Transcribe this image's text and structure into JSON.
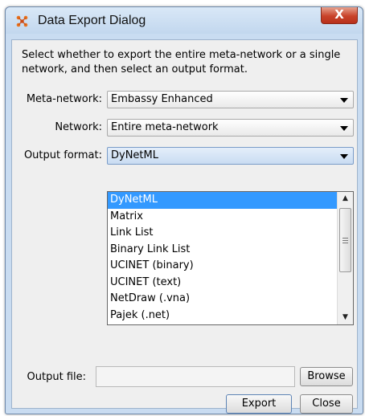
{
  "window": {
    "title": "Data Export Dialog",
    "close_label": "X"
  },
  "instructions": "Select whether to export the entire meta-network or a single network, and then select an output format.",
  "fields": {
    "meta_network": {
      "label": "Meta-network:",
      "value": "Embassy Enhanced"
    },
    "network": {
      "label": "Network:",
      "value": "Entire meta-network"
    },
    "output_format": {
      "label": "Output format:",
      "value": "DyNetML"
    }
  },
  "format_options": [
    "DyNetML",
    "Matrix",
    "Link List",
    "Binary Link List",
    "UCINET (binary)",
    "UCINET (text)",
    "NetDraw (.vna)",
    "Pajek (.net)"
  ],
  "selected_format_index": 0,
  "output_file": {
    "label": "Output file:",
    "value": "",
    "browse_label": "Browse"
  },
  "buttons": {
    "export": "Export",
    "close": "Close"
  },
  "colors": {
    "selection": "#3399ff",
    "close_button": "#c9432a"
  }
}
